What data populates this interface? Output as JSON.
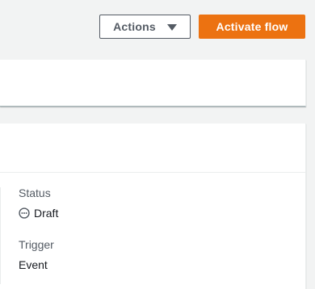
{
  "header": {
    "actions_label": "Actions",
    "activate_label": "Activate flow"
  },
  "details": {
    "status_label": "Status",
    "status_value": "Draft",
    "status_icon": "pending-icon",
    "trigger_label": "Trigger",
    "trigger_value": "Event"
  },
  "colors": {
    "primary_button": "#ec7211",
    "background": "#f2f3f3"
  }
}
